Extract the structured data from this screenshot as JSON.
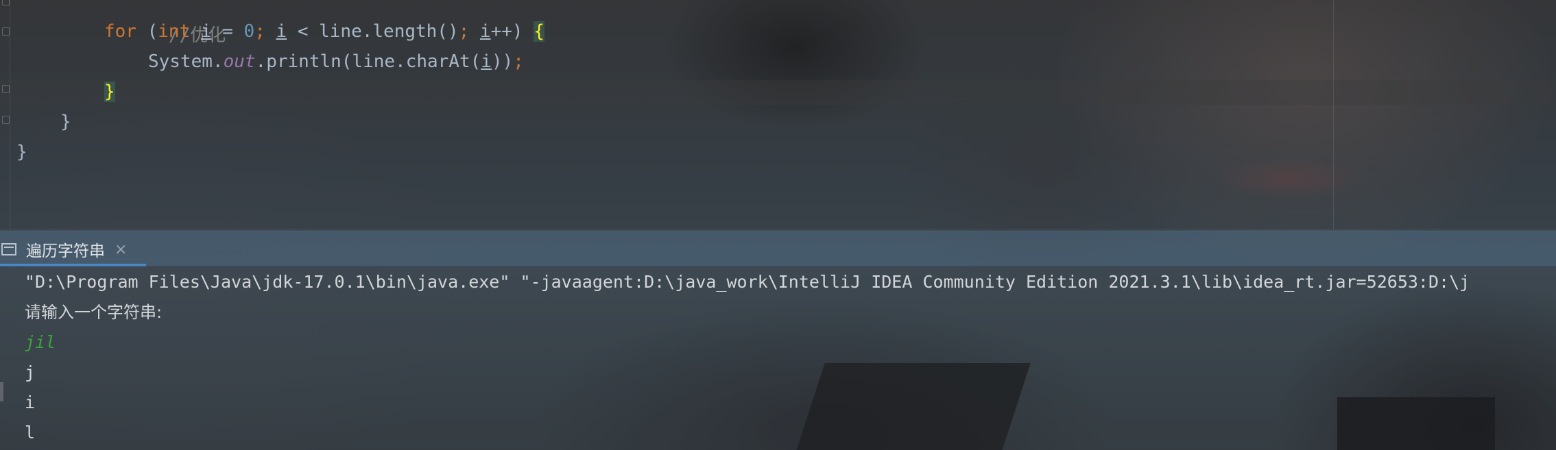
{
  "editor": {
    "lines": [
      {
        "comment": "//优化"
      },
      {
        "kw_for": "for",
        "paren_open": " (",
        "kw_int": "int",
        "sp1": " ",
        "var_i": "i",
        "assign": " = ",
        "zero": "0",
        "semi1": "; ",
        "var_i2": "i",
        "cond": " < line.length()",
        "semi2": "; ",
        "var_i3": "i",
        "incr": "++) ",
        "brace": "{"
      },
      {
        "system": "System.",
        "out": "out",
        "println": ".println(line.charAt(",
        "var_i": "i",
        "close": "))",
        "semi": ";"
      },
      {
        "brace": "}"
      },
      {
        "brace": "}"
      },
      {
        "brace": "}"
      }
    ]
  },
  "run_panel": {
    "tab_label": "遍历字符串",
    "tab_close": "×",
    "tab_icon": "console-window-icon"
  },
  "console": {
    "command_line": "\"D:\\Program Files\\Java\\jdk-17.0.1\\bin\\java.exe\" \"-javaagent:D:\\java_work\\IntelliJ IDEA Community Edition 2021.3.1\\lib\\idea_rt.jar=52653:D:\\j",
    "prompt": "请输入一个字符串:",
    "user_input": "jil",
    "outputs": [
      "j",
      "i",
      "l"
    ]
  },
  "colors": {
    "keyword": "#cc7832",
    "number": "#6897bb",
    "static_field": "#9876aa",
    "default_text": "#a9b7c6",
    "user_input": "#3aa53a",
    "tab_underline": "#4a88c7"
  }
}
